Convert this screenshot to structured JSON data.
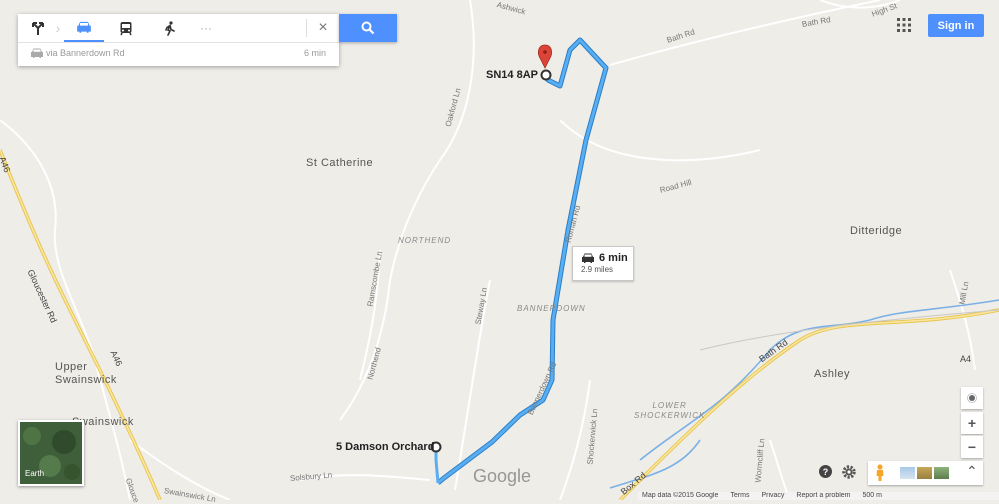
{
  "directions": {
    "modes": [
      {
        "name": "directions-icon",
        "active": false
      },
      {
        "name": "car-icon",
        "active": true
      },
      {
        "name": "transit-icon",
        "active": false
      },
      {
        "name": "walking-icon",
        "active": false
      },
      {
        "name": "more-icon",
        "active": false
      }
    ],
    "route_via": "via Bannerdown Rd",
    "route_time": "6 min"
  },
  "header": {
    "sign_in": "Sign in"
  },
  "route_info": {
    "time": "6 min",
    "distance": "2.9 miles"
  },
  "markers": {
    "destination": "SN14 8AP",
    "origin": "5 Damson Orchard"
  },
  "places": {
    "st_catherine": "St Catherine",
    "northend": "NORTHEND",
    "bannerdown": "BANNERDOWN",
    "ditteridge": "Ditteridge",
    "ashley": "Ashley",
    "upper_swainswick": "Upper\nSwainswick",
    "swainswick": "Swainswick",
    "lower_shockerwick": "LOWER\nSHOCKERWICK"
  },
  "roads": {
    "gloucester_rd": "Gloucester Rd",
    "a46_a": "A46",
    "a46_b": "A46",
    "oakford_ln": "Oakford Ln",
    "roman_rd": "Roman Rd",
    "bannerdown_rd": "Bannerdown Rd",
    "bath_rd_top": "Bath Rd",
    "bath_rd_top2": "Bath Rd",
    "high_st": "High St",
    "road_hill": "Road Hill",
    "ramscombe_ln": "Ramscombe Ln",
    "northend_rd": "Northend",
    "steway_ln": "Steway Ln",
    "shockerwick_ln": "Shockerwick Ln",
    "bath_rd_low": "Bath Rd",
    "a4": "A4",
    "box_rd": "Box Rd",
    "mill_ln": "Mill Ln",
    "solsbury_ln": "Solsbury Ln",
    "swainswick_ln": "Swainswick Ln",
    "wormcliff_ln": "Wormcliff Ln",
    "ashwick": "Ashwick",
    "gloucester_low": "Glouce"
  },
  "earth": {
    "label": "Earth"
  },
  "logo": "Google",
  "footer": {
    "map_data": "Map data ©2015 Google",
    "terms": "Terms",
    "privacy": "Privacy",
    "report": "Report a problem",
    "scale": "500 m"
  },
  "colors": {
    "route": "#4fa3e6",
    "route_outline": "#2a7fc9",
    "major_road": "#f5d76e",
    "water": "#7ab0e6",
    "pin": "#db4437",
    "accent": "#4d90fe"
  }
}
